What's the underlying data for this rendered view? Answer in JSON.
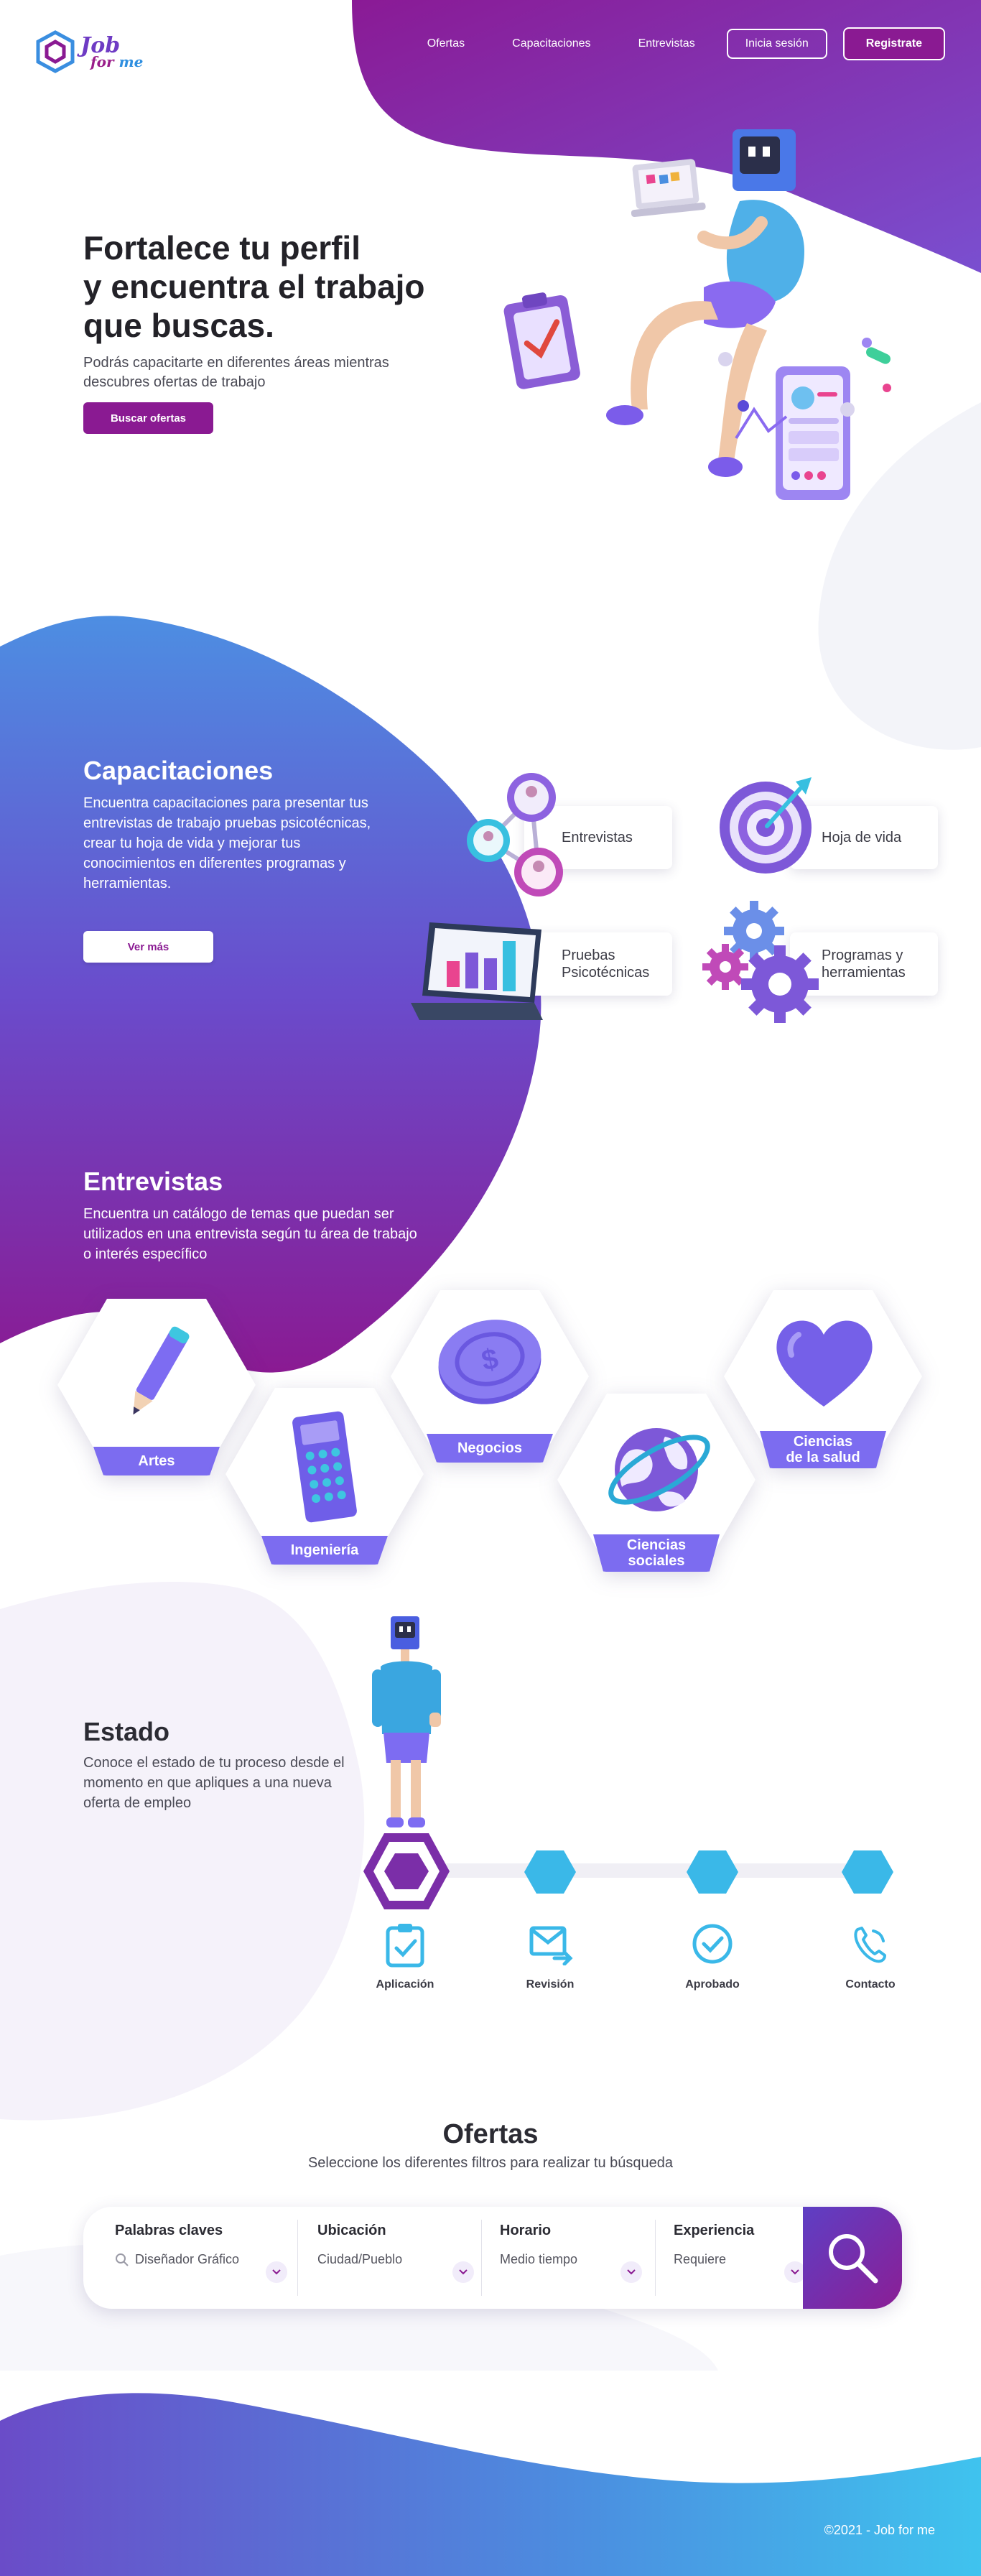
{
  "header": {
    "logo": {
      "word1": "Job",
      "word2_part1": "for",
      "word2_part2": "me"
    },
    "nav": [
      {
        "label": "Ofertas"
      },
      {
        "label": "Capacitaciones"
      },
      {
        "label": "Entrevistas"
      }
    ],
    "login_label": "Inicia sesión",
    "register_label": "Registrate"
  },
  "hero": {
    "title_line1": "Fortalece tu perfil",
    "title_line2": "y encuentra el trabajo",
    "title_line3": "que buscas.",
    "subtitle": "Podrás capacitarte en diferentes áreas mientras descubres ofertas de trabajo",
    "button_label": "Buscar ofertas"
  },
  "capacitaciones": {
    "title": "Capacitaciones",
    "text": "Encuentra capacitaciones para presentar tus entrevistas de trabajo pruebas psicotécnicas, crear tu hoja de vida y mejorar tus conocimientos en diferentes programas y herramientas.",
    "button_label": "Ver más",
    "cards": [
      {
        "label": "Entrevistas"
      },
      {
        "label": "Hoja de vida"
      },
      {
        "label_line1": "Pruebas",
        "label_line2": "Psicotécnicas"
      },
      {
        "label_line1": "Programas y",
        "label_line2": "herramientas"
      }
    ]
  },
  "entrevistas": {
    "title": "Entrevistas",
    "text": "Encuentra un catálogo de temas que puedan ser utilizados en una entrevista según tu área de trabajo o interés específico",
    "topics": [
      {
        "label": "Artes"
      },
      {
        "label": "Ingeniería"
      },
      {
        "label": "Negocios"
      },
      {
        "label_line1": "Ciencias",
        "label_line2": "sociales"
      },
      {
        "label_line1": "Ciencias",
        "label_line2": "de la salud"
      }
    ]
  },
  "estado": {
    "title": "Estado",
    "text": "Conoce el estado de tu proceso desde el momento en que apliques a una nueva oferta de empleo",
    "steps": [
      {
        "label": "Aplicación",
        "icon": "clipboard-check-icon"
      },
      {
        "label": "Revisión",
        "icon": "mail-forward-icon"
      },
      {
        "label": "Aprobado",
        "icon": "check-circle-icon"
      },
      {
        "label": "Contacto",
        "icon": "phone-icon"
      }
    ]
  },
  "ofertas": {
    "title": "Ofertas",
    "subtitle": "Seleccione los diferentes filtros para realizar tu búsqueda",
    "filters": [
      {
        "label": "Palabras claves",
        "value": "Diseñador Gráfico"
      },
      {
        "label": "Ubicación",
        "value": "Ciudad/Pueblo"
      },
      {
        "label": "Horario",
        "value": "Medio tiempo"
      },
      {
        "label": "Experiencia",
        "value": "Requiere"
      }
    ]
  },
  "footer": {
    "copyright": "©2021 - Job for me"
  },
  "colors": {
    "brand_purple": "#8a1a92",
    "violet": "#7c6cf0",
    "blue": "#4a8fe0",
    "cyan": "#3ab8e8"
  }
}
